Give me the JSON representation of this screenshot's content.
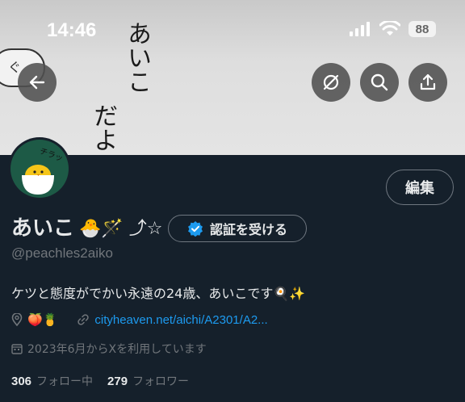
{
  "status_bar": {
    "time": "14:46",
    "battery": "88",
    "icons": [
      "signal-icon",
      "wifi-icon",
      "battery-icon"
    ]
  },
  "banner": {
    "text_lines": [
      "あいこ",
      "だよ"
    ],
    "doodle_text": "ぐ"
  },
  "header_buttons": {
    "icons": [
      "back-arrow-icon",
      "mute-circle-icon",
      "search-icon",
      "share-icon"
    ]
  },
  "avatar": {
    "caption": "チラッ"
  },
  "edit_button": {
    "label": "編集"
  },
  "profile": {
    "display_name": "あいこ",
    "name_emojis": "🐣🪄 ︎⤴︎☆",
    "verify_label": "認証を受ける",
    "handle": "@peachles2aiko",
    "bio": "ケツと態度がでかい永遠の24歳、あいこです🍳✨",
    "location": "🍑🍍",
    "link": "cityheaven.net/aichi/A2301/A2...",
    "joined": "2023年6月からXを利用しています"
  },
  "stats": {
    "following_count": "306",
    "following_label": "フォロー中",
    "followers_count": "279",
    "followers_label": "フォロワー"
  },
  "colors": {
    "background": "#15202b",
    "link": "#1d9bf0",
    "verified_badge": "#1d9bf0",
    "muted_text": "#71767b"
  }
}
